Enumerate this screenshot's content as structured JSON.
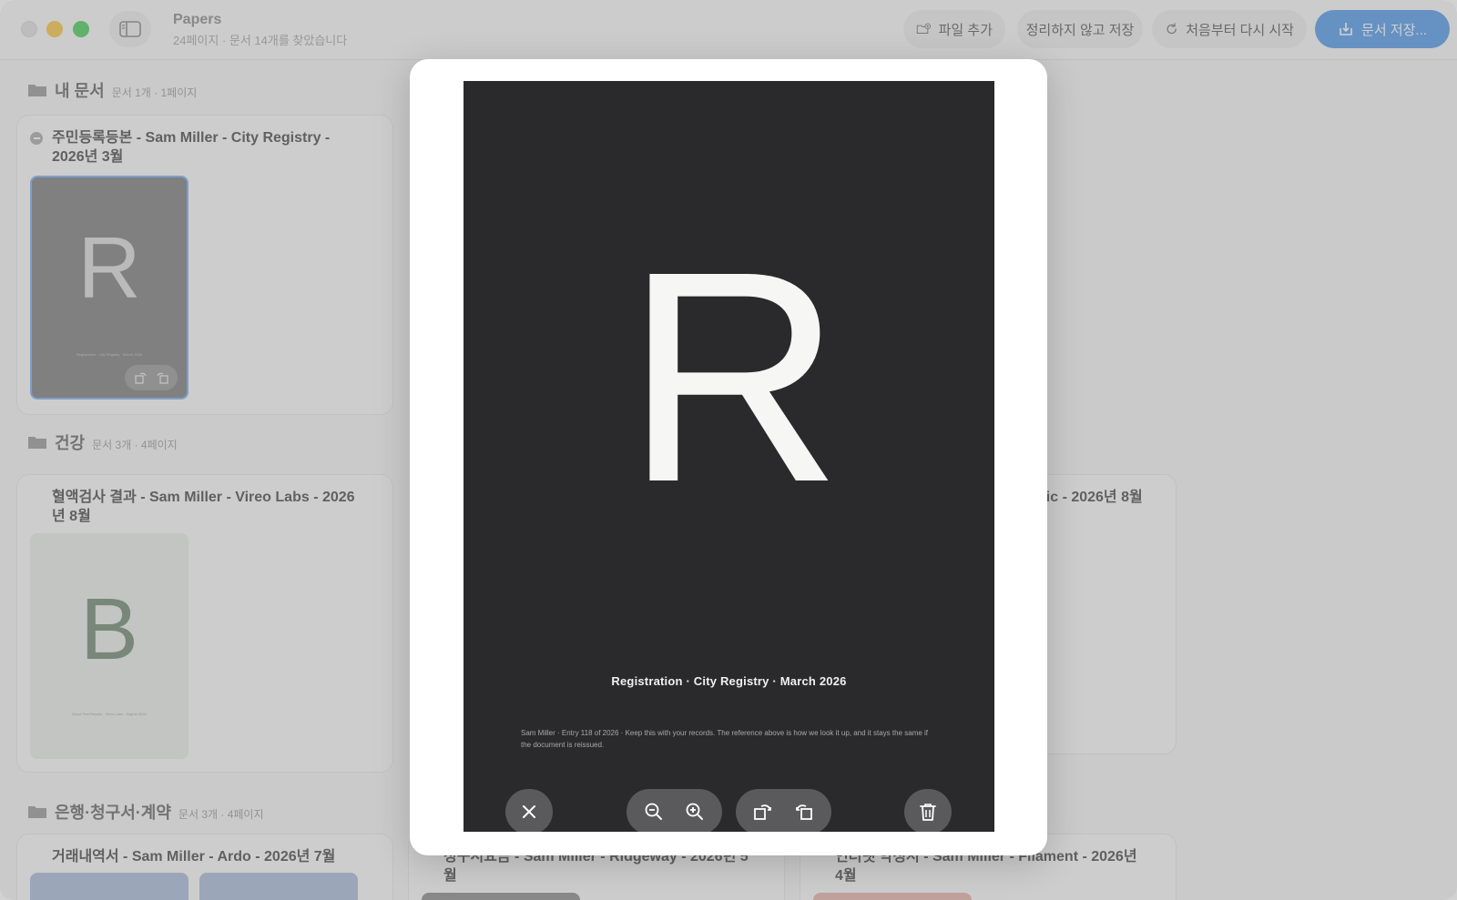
{
  "window": {
    "title": "Papers",
    "subtitle": "24페이지 · 문서 14개를 찾았습니다"
  },
  "toolbar": {
    "add_file": "파일 추가",
    "save_unsorted": "정리하지 않고 저장",
    "restart": "처음부터 다시 시작",
    "save_documents": "문서 저장..."
  },
  "sections": [
    {
      "title": "내 문서",
      "meta": "문서 1개 · 1페이지",
      "cards": [
        {
          "title": "주민등록등본 - Sam Miller - City Registry - 2026년 3월",
          "thumb_letter": "R",
          "thumb_caption": "Registration · City Registry · March 2026"
        }
      ]
    },
    {
      "title": "건강",
      "meta": "문서 3개 · 4페이지",
      "cards": [
        {
          "title": "혈액검사 결과 - Sam Miller - Vireo Labs - 2026년 8월",
          "thumb_letter": "B",
          "thumb_caption": "Blood Test Results · Vireo Labs · August 2026"
        },
        {
          "title": "nic - 2026년 8월"
        }
      ]
    },
    {
      "title": "은행·청구서·계약",
      "meta": "문서 3개 · 4페이지",
      "cards": [
        {
          "title": "거래내역서 - Sam Miller - Ardo - 2026년 7월"
        },
        {
          "title": "청구서요금 - Sam Miller - Ridgeway - 2026년 5월"
        },
        {
          "title": "인터넷 약정서 - Sam Miller - Filament - 2026년 4월"
        }
      ]
    }
  ],
  "preview": {
    "letter": "R",
    "caption": "Registration · City Registry · March 2026",
    "note": "Sam Miller · Entry 118 of 2026 · Keep this with your records. The reference above is how we look it up, and it stays the same if the document is reissued."
  },
  "colors": {
    "accent": "#3d8ee8",
    "traffic_min": "#f8bd2f",
    "traffic_max": "#33c748",
    "page_background": "#2a2a2c"
  }
}
